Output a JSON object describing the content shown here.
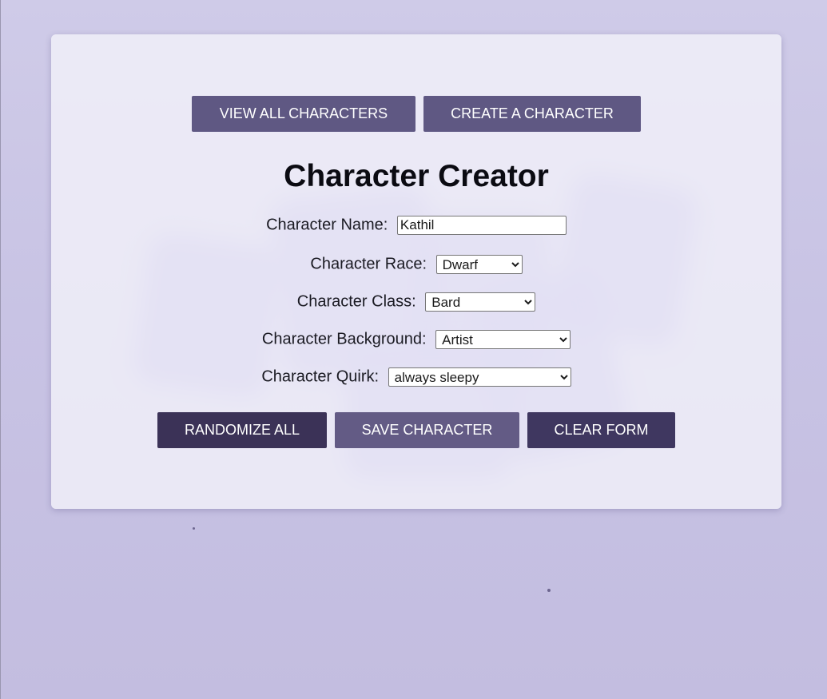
{
  "nav": {
    "view_all_label": "VIEW ALL CHARACTERS",
    "create_label": "CREATE A CHARACTER"
  },
  "page_title": "Character Creator",
  "form": {
    "name": {
      "label": "Character Name:",
      "value": "Kathil"
    },
    "race": {
      "label": "Character Race:",
      "value": "Dwarf"
    },
    "class": {
      "label": "Character Class:",
      "value": "Bard"
    },
    "background": {
      "label": "Character Background:",
      "value": "Artist"
    },
    "quirk": {
      "label": "Character Quirk:",
      "value": "always sleepy"
    }
  },
  "actions": {
    "randomize_label": "RANDOMIZE ALL",
    "save_label": "SAVE CHARACTER",
    "clear_label": "CLEAR FORM"
  },
  "colors": {
    "nav_button": "#5f5883",
    "randomize_button": "#3b3257",
    "save_button": "#635b85",
    "clear_button": "#3f3760",
    "background": "#c8c3e4"
  }
}
